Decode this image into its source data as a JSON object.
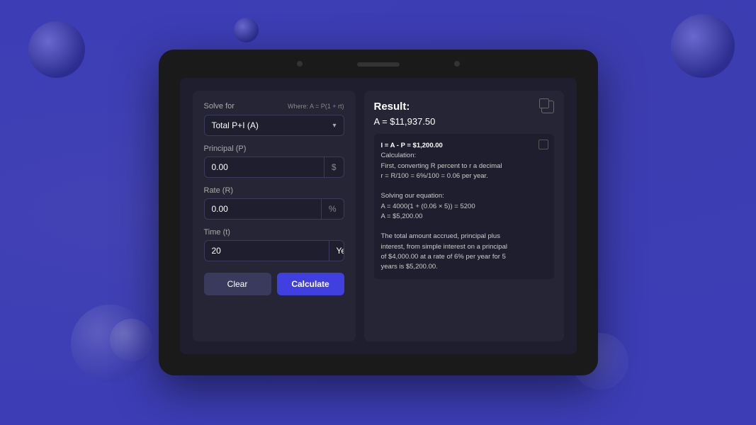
{
  "background": {
    "color": "#3d3db5"
  },
  "calculator": {
    "solve_for_label": "Solve for",
    "formula_label": "Where: A = P(1 + rt)",
    "solve_for_value": "Total P+I (A)",
    "principal_label": "Principal (P)",
    "principal_value": "0.00",
    "principal_suffix": "$",
    "rate_label": "Rate (R)",
    "rate_value": "0.00",
    "rate_suffix": "%",
    "time_label": "Time (t)",
    "time_value": "20",
    "time_unit": "Years",
    "clear_label": "Clear",
    "calculate_label": "Calculate"
  },
  "result": {
    "title": "Result:",
    "main_value": "A = $11,937.50",
    "detail": {
      "line1": "I = A - P = $1,200.00",
      "line2": "Calculation:",
      "line3": "First, converting R percent to r a decimal",
      "line4": "r = R/100 = 6%/100 = 0.06 per year.",
      "line5": "",
      "line6": "Solving our equation:",
      "line7": "A = 4000(1 + (0.06 × 5)) = 5200",
      "line8": "A = $5,200.00",
      "line9": "",
      "line10": "The total amount accrued, principal plus",
      "line11": "interest, from simple interest on a principal",
      "line12": "of $4,000.00 at a rate of 6% per year for 5",
      "line13": "years is $5,200.00."
    }
  }
}
